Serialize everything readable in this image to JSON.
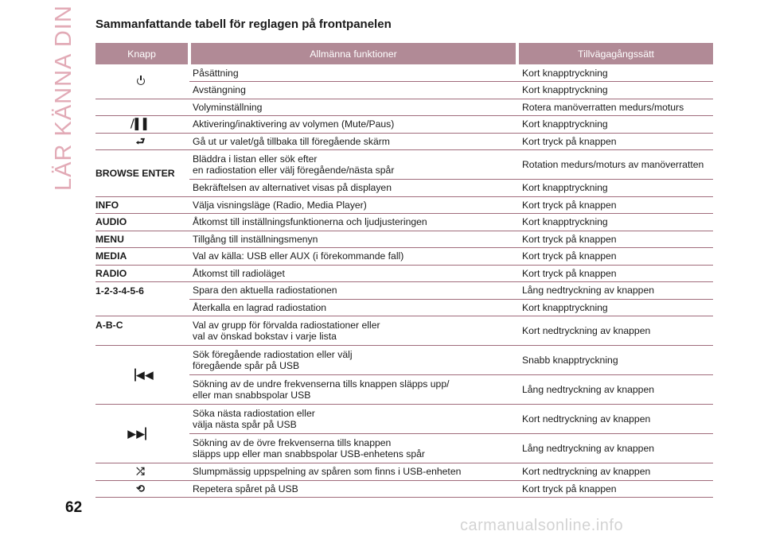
{
  "side_title": "LÄR KÄNNA DIN BIL",
  "page_number": "62",
  "watermark": "carmanualsonline.info",
  "heading": "Sammanfattande tabell för reglagen på frontpanelen",
  "columns": {
    "knapp": "Knapp",
    "functions": "Allmänna funktioner",
    "method": "Tillvägagångssätt"
  },
  "rows": {
    "r1": {
      "func": "Påsättning",
      "method": "Kort knapptryckning"
    },
    "r2": {
      "func": "Avstängning",
      "method": "Kort knapptryckning"
    },
    "r3": {
      "func": "Volyminställning",
      "method": "Rotera manöverratten medurs/moturs"
    },
    "r4": {
      "icon": "mute-pause-icon",
      "glyph": "⧸▌▌",
      "func": "Aktivering/inaktivering av volymen (Mute/Paus)",
      "method": "Kort knapptryckning"
    },
    "r5": {
      "icon": "back-icon",
      "glyph": "⮐",
      "func": "Gå ut ur valet/gå tillbaka till föregående skärm",
      "method": "Kort tryck på knappen"
    },
    "r6": {
      "knapp": "BROWSE ENTER",
      "func_l1": "Bläddra i listan eller sök efter",
      "func_l2": "en radiostation eller välj föregående/nästa spår",
      "method": "Rotation medurs/moturs av manöverratten"
    },
    "r7": {
      "func": "Bekräftelsen av alternativet visas på displayen",
      "method": "Kort knapptryckning"
    },
    "r8": {
      "knapp": "INFO",
      "func": "Välja visningsläge (Radio, Media Player)",
      "method": "Kort tryck på knappen"
    },
    "r9": {
      "knapp": "AUDIO",
      "func": "Åtkomst till inställningsfunktionerna och ljudjusteringen",
      "method": "Kort knapptryckning"
    },
    "r10": {
      "knapp": "MENU",
      "func": "Tillgång till inställningsmenyn",
      "method": "Kort tryck på knappen"
    },
    "r11": {
      "knapp": "MEDIA",
      "func": "Val av källa: USB eller AUX (i förekommande fall)",
      "method": "Kort tryck på knappen"
    },
    "r12": {
      "knapp": "RADIO",
      "func": "Åtkomst till radioläget",
      "method": "Kort tryck på knappen"
    },
    "r13": {
      "knapp": "1-2-3-4-5-6",
      "func": "Spara den aktuella radiostationen",
      "method": "Lång nedtryckning av knappen"
    },
    "r14": {
      "func": "Återkalla en lagrad radiostation",
      "method": "Kort knapptryckning"
    },
    "r15": {
      "knapp": "A-B-C",
      "func_l1": "Val av grupp för förvalda radiostationer eller",
      "func_l2": "val av önskad bokstav i varje lista",
      "method": "Kort nedtryckning av knappen"
    },
    "r16": {
      "icon": "previous-icon",
      "glyph": "▕◀◀",
      "func_l1": "Sök föregående radiostation eller välj",
      "func_l2": " föregående spår på USB",
      "method": "Snabb knapptryckning"
    },
    "r17": {
      "func_l1": "Sökning av de undre frekvenserna tills knappen släpps upp/",
      "func_l2": " eller man snabbspolar USB",
      "method": "Lång nedtryckning av knappen"
    },
    "r18": {
      "icon": "next-icon",
      "glyph": "▶▶▏",
      "func_l1": "Söka nästa radiostation eller",
      "func_l2": "välja nästa spår på USB",
      "method": " Kort nedtryckning av knappen"
    },
    "r19": {
      "func_l1": "Sökning av de övre frekvenserna tills knappen",
      "func_l2": "släpps upp eller man snabbspolar USB-enhetens spår",
      "method": "Lång nedtryckning av knappen"
    },
    "r20": {
      "icon": "shuffle-icon",
      "glyph": "⤮",
      "func": "Slumpmässig uppspelning av spåren som finns i USB-enheten",
      "method": "Kort nedtryckning av knappen"
    },
    "r21": {
      "icon": "repeat-icon",
      "glyph": "⟲",
      "func": "Repetera spåret på USB",
      "method": "Kort tryck på knappen"
    }
  }
}
